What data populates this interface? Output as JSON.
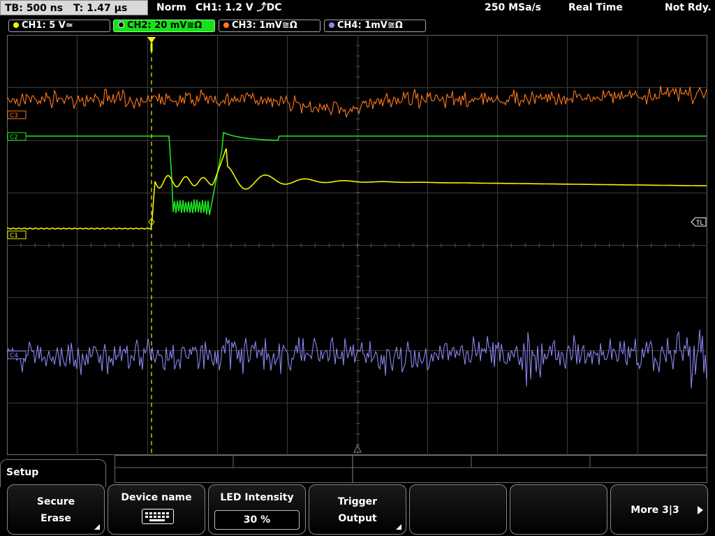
{
  "status_bar": {
    "timebase": "TB: 500 ns",
    "trigger_time": "T: 1.47 µs",
    "trigger_mode": "Norm",
    "trigger_source": "CH1: 1.2 V ⤴DC",
    "sample_rate": "250 MSa/s",
    "acq_mode": "Real Time",
    "state": "Not Rdy."
  },
  "channels": [
    {
      "label": "CH1: 5 V≃",
      "color": "#f5f500",
      "active": false
    },
    {
      "label": "CH2: 20 mV≅Ω",
      "color": "#1ee61e",
      "active": true
    },
    {
      "label": "CH3: 1mV≅Ω",
      "color": "#ff7a1a",
      "active": false
    },
    {
      "label": "CH4: 1mV≅Ω",
      "color": "#8a86f0",
      "active": false
    }
  ],
  "markers": {
    "c1": "C1",
    "c2": "C2",
    "c3": "C3",
    "c4": "C4",
    "trigger_level": "TL"
  },
  "menu": {
    "title": "Setup",
    "softkeys": [
      {
        "line1": "Secure",
        "line2": "Erase",
        "submenu": true
      },
      {
        "line1": "Device name",
        "icon": "keyboard-icon"
      },
      {
        "line1": "LED Intensity",
        "value": "30 %"
      },
      {
        "line1": "Trigger",
        "line2": "Output",
        "submenu": true
      },
      {
        "line1": ""
      },
      {
        "line1": ""
      },
      {
        "line1": "More 3|3"
      }
    ]
  },
  "colors": {
    "ch1": "#f5f500",
    "ch2": "#1ee61e",
    "ch3": "#ff7a1a",
    "ch4": "#8a86f0",
    "grid": "#3c3c3c"
  }
}
